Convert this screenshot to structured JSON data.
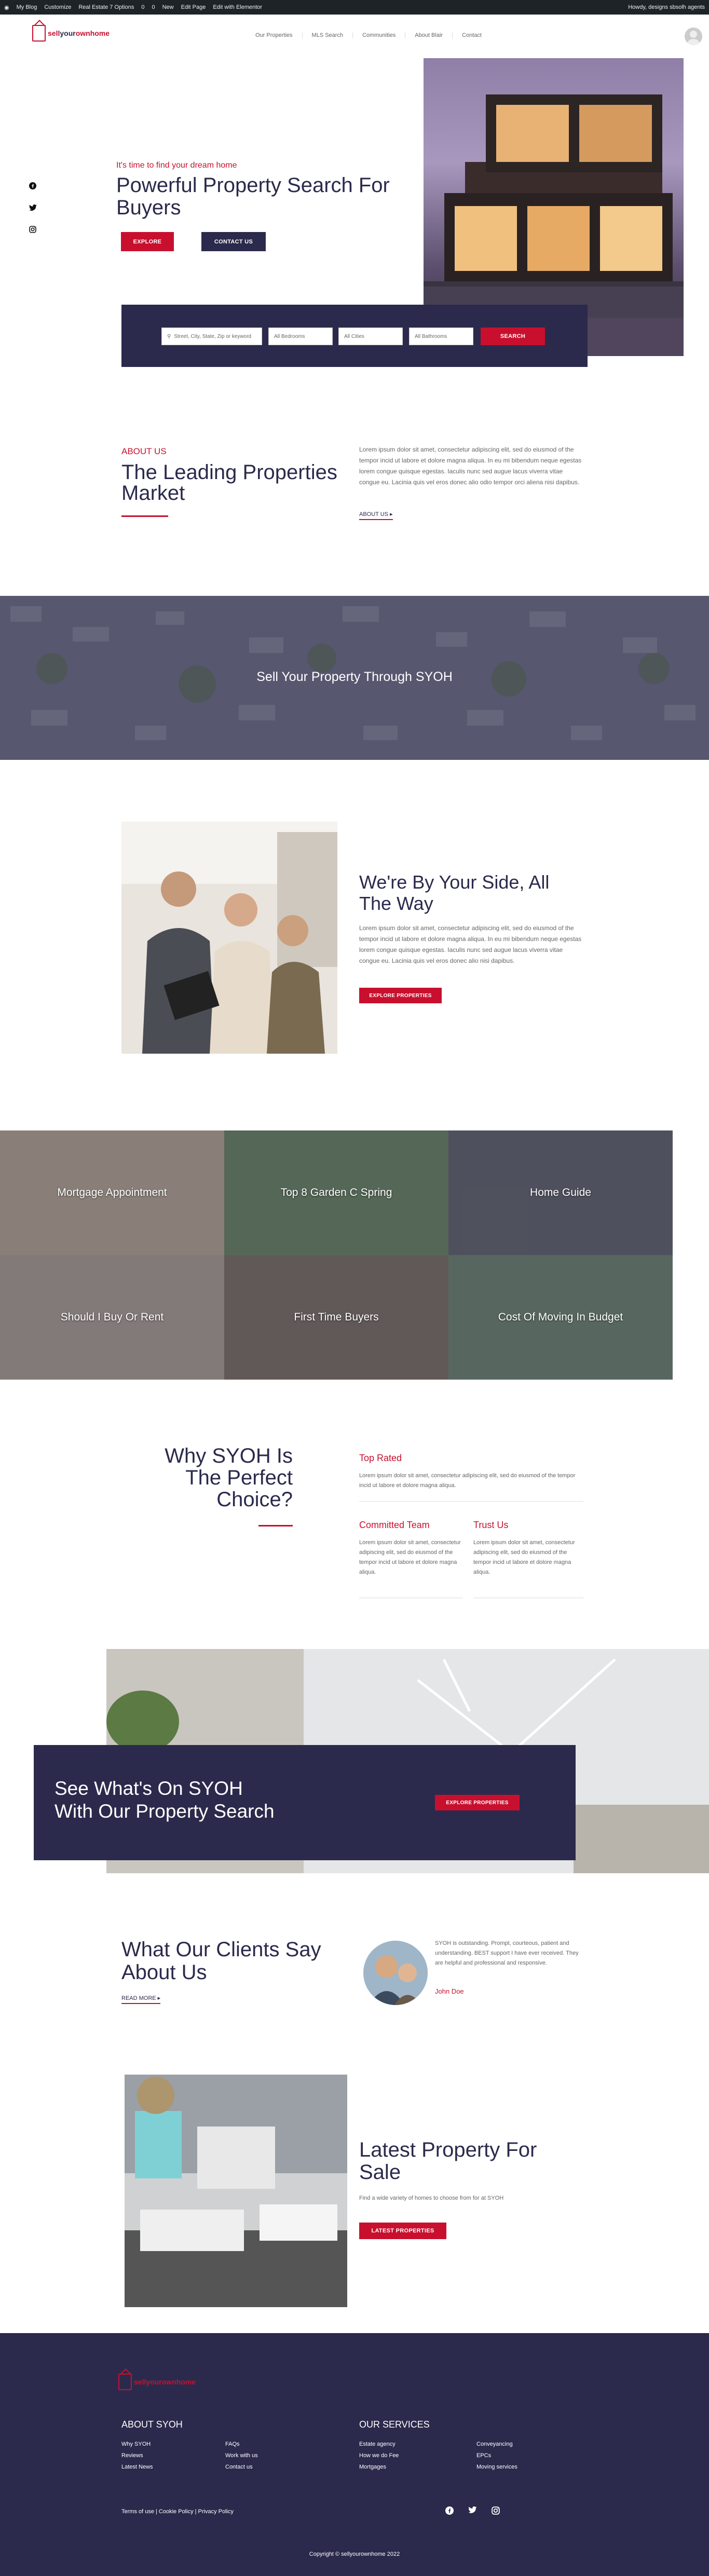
{
  "admin_bar": {
    "items": [
      "My Blog",
      "Customize",
      "Real Estate 7 Options",
      "0",
      "0",
      "New",
      "Edit Page",
      "Edit with Elementor"
    ],
    "howdy": "Howdy, designs sbsolh agents"
  },
  "header": {
    "logo_prefix": "sell",
    "logo_mid": "your",
    "logo_suffix": "ownhome",
    "nav": [
      "Our Properties",
      "MLS Search",
      "Communities",
      "About Blair",
      "Contact"
    ]
  },
  "hero": {
    "tagline": "It's time to find your dream home",
    "title_line1": "Powerful Property Search For",
    "title_line2": "Buyers",
    "explore_label": "EXPLORE",
    "contact_label": "CONTACT US",
    "social_icons": [
      "facebook-icon",
      "twitter-icon",
      "instagram-icon"
    ]
  },
  "search": {
    "keyword_placeholder": "Street, City, State, Zip or keyword",
    "beds_label": "All Bedrooms",
    "city_label": "All Cities",
    "type_label": "All Bathrooms",
    "button_label": "SEARCH"
  },
  "about": {
    "kicker": "ABOUT US",
    "title_line1": "The Leading Properties",
    "title_line2": "Market",
    "body": "Lorem ipsum dolor sit amet, consectetur adipiscing elit, sed do eiusmod of the tempor incid ut labore et dolore magna aliqua. In eu mi bibendum neque egestas lorem congue quisque egestas. Iaculis nunc sed augue lacus viverra vitae congue eu. Lacinia quis vel eros donec alio odio tempor orci aliena nisi dapibus.",
    "link": "ABOUT US ▸"
  },
  "sell_banner": {
    "text": "Sell Your Property Through SYOH"
  },
  "side": {
    "title_line1": "We're By Your Side, All",
    "title_line2": "The Way",
    "body": "Lorem ipsum dolor sit amet, consectetur adipiscing elit, sed do eiusmod of the tempor incid ut labore et dolore magna aliqua. In eu mi bibendum neque egestas lorem congue quisque egestas. Iaculis nunc sed augue lacus viverra vitae congue eu. Lacinia quis vel eros donec alio nisi dapibus.",
    "button": "EXPLORE PROPERTIES"
  },
  "tiles": [
    {
      "label": "Mortgage Appointment",
      "color": "#c9b79a"
    },
    {
      "label": "Top 8 Garden C Spring",
      "color": "#6a8b5e"
    },
    {
      "label": "Home Guide",
      "color": "#5f6268"
    },
    {
      "label": "Should I Buy Or Rent",
      "color": "#bcae9a"
    },
    {
      "label": "First Time Buyers",
      "color": "#80725f"
    },
    {
      "label": "Cost Of Moving In Budget",
      "color": "#6e8a6d"
    }
  ],
  "why": {
    "title_line1": "Why SYOH Is",
    "title_line2": "The Perfect",
    "title_line3": "Choice?",
    "top_rated": "Top Rated",
    "top_rated_body": "Lorem ipsum dolor sit amet, consectetur adipiscing elit, sed do eiusmod of the tempor incid ut labore et dolore magna aliqua.",
    "committed": "Committed Team",
    "committed_body": "Lorem ipsum dolor sit amet, consectetur adipiscing elit, sed do eiusmod of the tempor incid ut labore et dolore magna aliqua.",
    "trust": "Trust Us",
    "trust_body": "Lorem ipsum dolor sit amet, consectetur adipiscing elit, sed do eiusmod of the tempor incid ut labore et dolore magna aliqua."
  },
  "cta": {
    "line1": "See What's On SYOH",
    "line2": "With Our Property Search",
    "button": "EXPLORE PROPERTIES"
  },
  "clients": {
    "title_line1": "What Our Clients Say",
    "title_line2": "About Us",
    "link": "READ MORE ▸",
    "quote": "SYOH is outstanding. Prompt, courteous, patient and understanding. BEST support I have ever received. They are helpful and professional and responsive.",
    "author": "John Doe"
  },
  "latest": {
    "title_line1": "Latest Property For",
    "title_line2": "Sale",
    "body": "Find a wide variety of homes to choose from for at SYOH",
    "button": "LATEST PROPERTIES"
  },
  "footer": {
    "col1_title": "ABOUT SYOH",
    "col1_a": [
      "Why SYOH",
      "Reviews",
      "Latest News"
    ],
    "col1_b": [
      "FAQs",
      "Work with us",
      "Contact us"
    ],
    "col2_title": "OUR SERVICES",
    "col2_a": [
      "Estate agency",
      "How we do Fee",
      "Mortgages"
    ],
    "col2_b": [
      "Conveyancing",
      "EPCs",
      "Moving services"
    ],
    "legal": "Terms of use | Cookie Policy | Privacy Policy",
    "copyright": "Copyright © sellyourownhome 2022"
  },
  "colors": {
    "accent": "#c8102e",
    "navy": "#2b2a4c"
  }
}
